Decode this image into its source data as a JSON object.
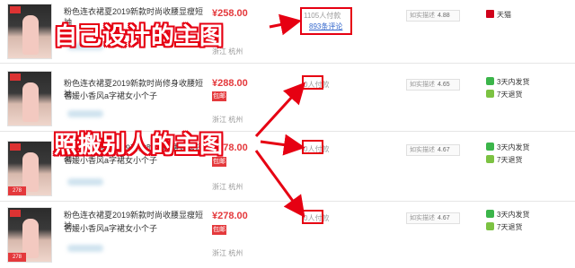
{
  "products": [
    {
      "title": "粉色连衣裙夏2019新款时尚收腰显瘦短袖",
      "price": "¥258.00",
      "sales": "1105人付款",
      "comments": "893条评论",
      "location": "浙江 杭州",
      "rating_label": "如实描述",
      "rating_score": "4.88",
      "service_label": "天猫",
      "service_icon": "tmall-icon"
    },
    {
      "title_line1": "粉色连衣裙夏2019新款时尚修身收腰短袖",
      "title_line2": "名媛小香风a字裙女小个子",
      "price": "¥288.00",
      "tag": "包邮",
      "sales": "0人付款",
      "location": "浙江 杭州",
      "rating_label": "如实描述",
      "rating_score": "4.65",
      "service_line1": "3天内发货",
      "service_line2": "7天退货"
    },
    {
      "title_line1": "粉色连衣裙夏2019新款时尚收腰显瘦短袖",
      "title_line2": "名媛小香风a字裙女小个子",
      "price": "¥278.00",
      "tag": "包邮",
      "sales": "0人付款",
      "location": "浙江 杭州",
      "rating_label": "如实描述",
      "rating_score": "4.67",
      "service_line1": "3天内发货",
      "service_line2": "7天退货"
    },
    {
      "title_line1": "粉色连衣裙夏2019新款时尚收腰显瘦短袖",
      "title_line2": "名媛小香风a字裙女小个子",
      "price": "¥278.00",
      "tag": "包邮",
      "sales": "0人付款",
      "location": "浙江 杭州",
      "rating_label": "如实描述",
      "rating_score": "4.67",
      "service_line1": "3天内发货",
      "service_line2": "7天退货"
    }
  ],
  "annotations": {
    "own_design": "自己设计的主图",
    "copied": "照搬别人的主图",
    "accent_color": "#e60012"
  },
  "icons": {
    "ship": "truck-icon",
    "return": "return-icon"
  }
}
